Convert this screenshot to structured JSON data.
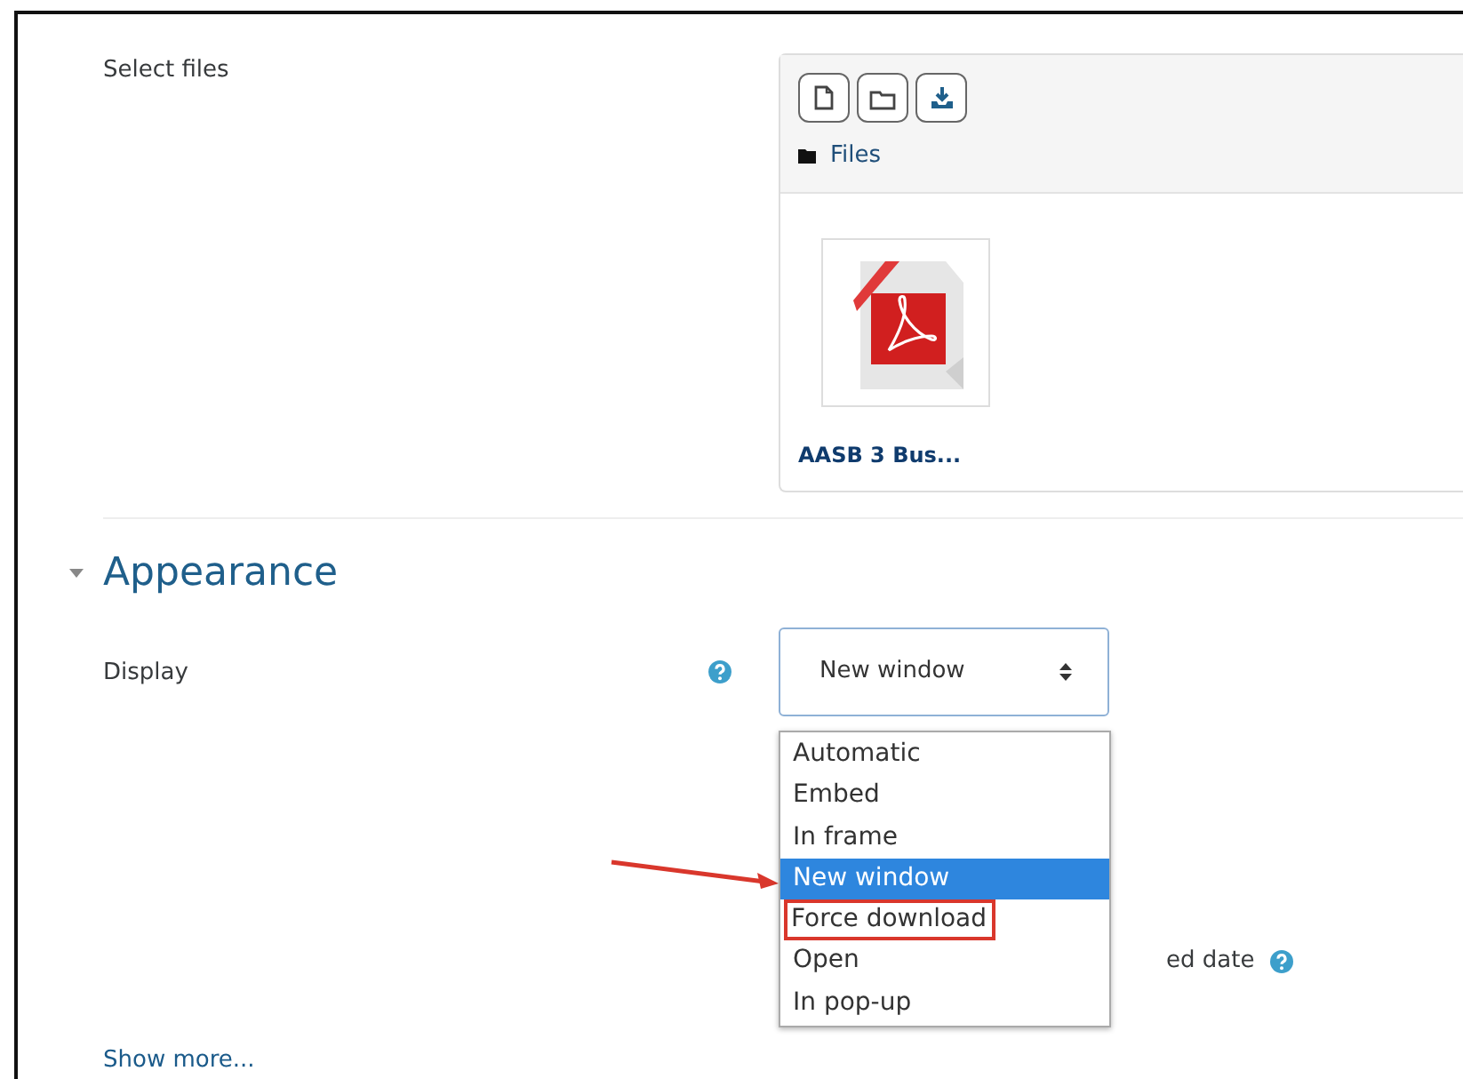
{
  "select_files": {
    "label": "Select files",
    "toolbar": [
      {
        "kind": "add-file"
      },
      {
        "kind": "add-folder"
      },
      {
        "kind": "download"
      }
    ],
    "path": "Files",
    "files": [
      {
        "name": "AASB 3 Bus...",
        "kind": "pdf"
      }
    ]
  },
  "appearance": {
    "title": "Appearance",
    "expanded": true,
    "display": {
      "label": "Display",
      "value": "New window",
      "options": [
        {
          "label": "Automatic",
          "selected": false,
          "annotated": false
        },
        {
          "label": "Embed",
          "selected": false,
          "annotated": false
        },
        {
          "label": "In frame",
          "selected": false,
          "annotated": false
        },
        {
          "label": "New window",
          "selected": true,
          "annotated": false
        },
        {
          "label": "Force download",
          "selected": false,
          "annotated": true
        },
        {
          "label": "Open",
          "selected": false,
          "annotated": false
        },
        {
          "label": "In pop-up",
          "selected": false,
          "annotated": false
        }
      ]
    },
    "covered_option": {
      "label": "ed date"
    },
    "show_more": "Show more..."
  }
}
